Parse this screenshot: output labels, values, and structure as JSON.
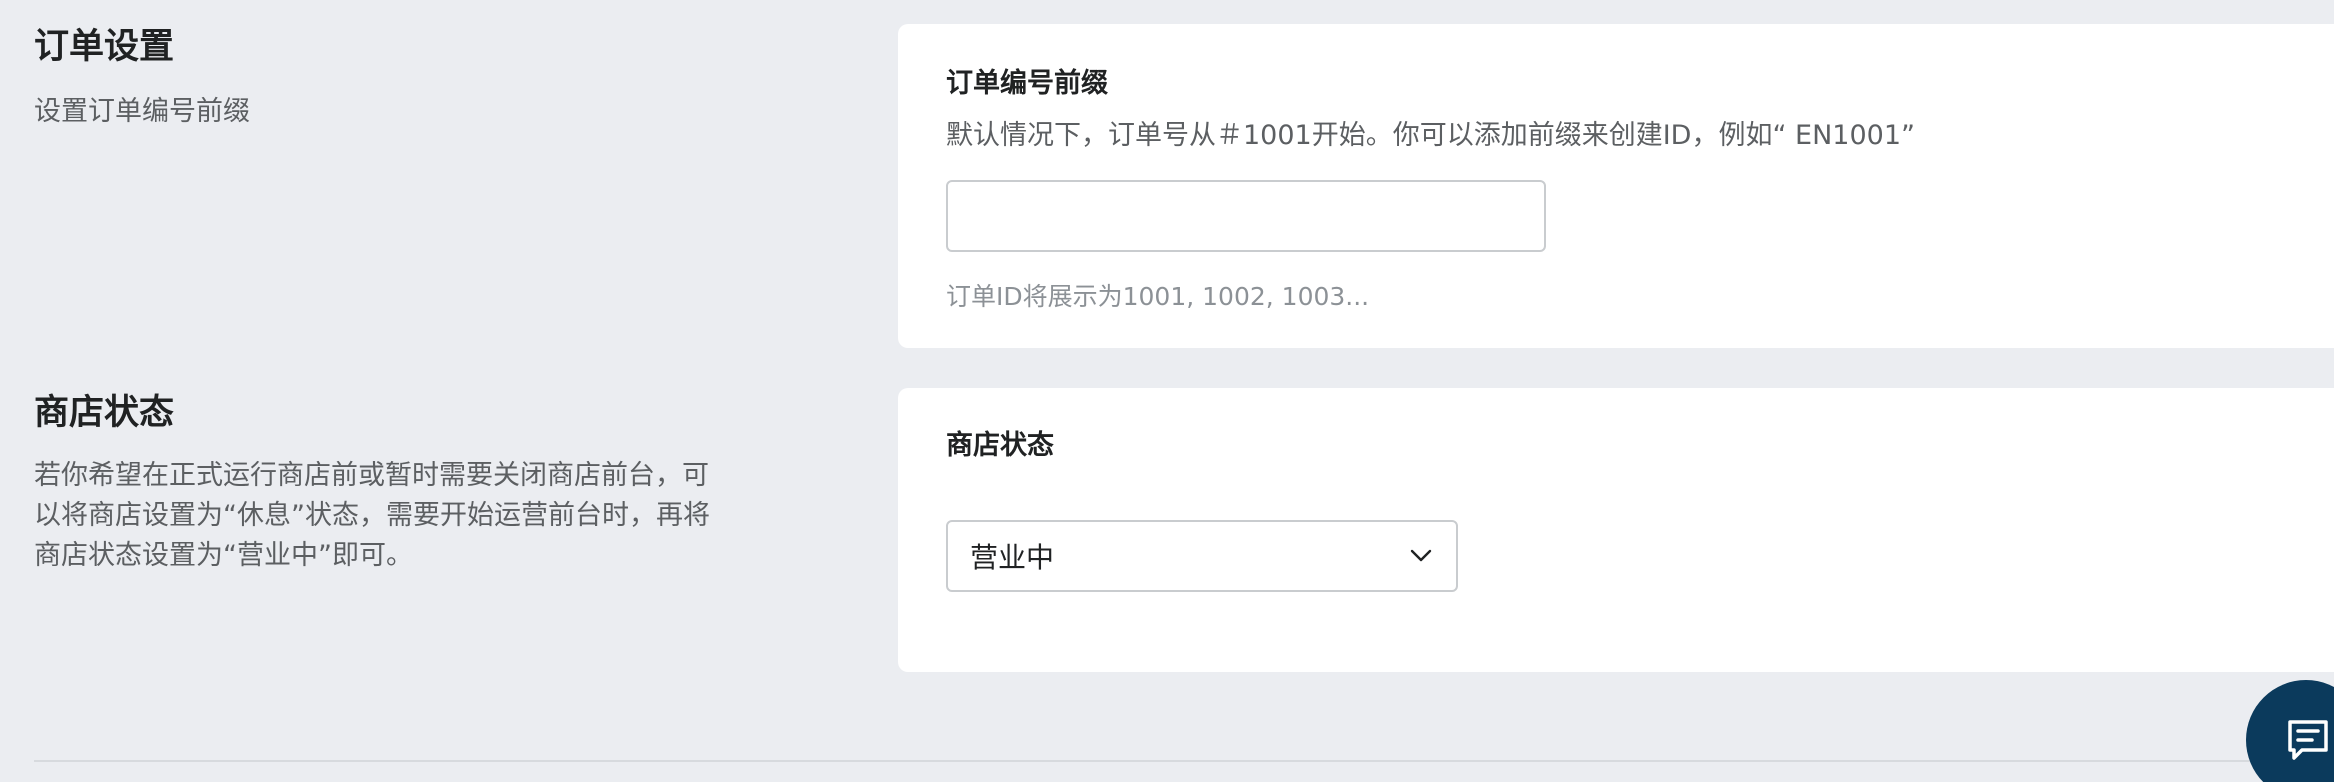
{
  "order_settings": {
    "title": "订单设置",
    "description": "设置订单编号前缀",
    "card": {
      "label": "订单编号前缀",
      "help": "默认情况下，订单号从＃1001开始。你可以添加前缀来创建ID，例如“ EN1001”",
      "input_value": "",
      "input_placeholder": "",
      "hint": "订单ID将展示为1001, 1002, 1003..."
    }
  },
  "store_status": {
    "title": "商店状态",
    "description_lines": [
      "若你希望在正式运行商店前或暂时需要关闭商店前台，可",
      "以将商店设置为“休息”状态，需要开始运营前台时，再将",
      "商店状态设置为“营业中”即可。"
    ],
    "card": {
      "label": "商店状态",
      "select_value": "营业中"
    }
  },
  "icons": {
    "chevron": "chevron-down-icon",
    "chat": "chat-icon"
  },
  "colors": {
    "background": "#ebedf1",
    "card": "#ffffff",
    "chat_button": "#0b3a5c",
    "text_primary": "#202223",
    "text_secondary": "#5c5f62",
    "text_hint": "#8c9196"
  }
}
